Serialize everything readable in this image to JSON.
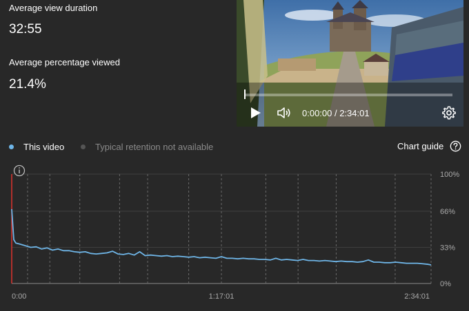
{
  "stats": {
    "avg_duration_label": "Average view duration",
    "avg_duration_value": "32:55",
    "avg_percent_label": "Average percentage viewed",
    "avg_percent_value": "21.4%"
  },
  "player": {
    "current_time": "0:00:00",
    "total_time": "2:34:01",
    "separator": " / ",
    "icons": [
      "play-icon",
      "volume-icon",
      "gear-icon"
    ]
  },
  "legend": {
    "this_video": "This video",
    "this_video_color": "#6fb6e8",
    "typical": "Typical retention not available",
    "typical_color": "#555555"
  },
  "chart_guide": {
    "label": "Chart guide",
    "icon": "help-icon"
  },
  "chart_data": {
    "type": "line",
    "title": "",
    "xlabel": "",
    "ylabel": "",
    "x_ticks": [
      "0:00",
      "1:17:01",
      "2:34:01"
    ],
    "y_ticks": [
      "100%",
      "66%",
      "33%",
      "0%"
    ],
    "ylim": [
      0,
      100
    ],
    "xlim": [
      "0:00",
      "2:34:01"
    ],
    "grid": true,
    "series": [
      {
        "color": "#6fb6e8",
        "x": [
          "0:00",
          "0:45",
          "1:30",
          "3:00",
          "5:00",
          "7:00",
          "9:00",
          "11:00",
          "13:00",
          "15:00",
          "17:00",
          "19:00",
          "21:00",
          "23:00",
          "25:00",
          "27:00",
          "29:00",
          "31:00",
          "33:00",
          "35:00",
          "37:00",
          "39:00",
          "41:00",
          "43:00",
          "45:00",
          "47:00",
          "49:00",
          "51:00",
          "53:00",
          "55:00",
          "57:00",
          "59:00",
          "1:01:00",
          "1:03:00",
          "1:05:00",
          "1:07:00",
          "1:09:00",
          "1:11:00",
          "1:13:00",
          "1:15:00",
          "1:17:01",
          "1:19:00",
          "1:21:00",
          "1:23:00",
          "1:25:00",
          "1:27:00",
          "1:29:00",
          "1:31:00",
          "1:33:00",
          "1:35:00",
          "1:37:00",
          "1:39:00",
          "1:41:00",
          "1:43:00",
          "1:45:00",
          "1:47:00",
          "1:49:00",
          "1:51:00",
          "1:53:00",
          "1:55:00",
          "1:57:00",
          "1:59:00",
          "2:01:00",
          "2:03:00",
          "2:05:00",
          "2:07:00",
          "2:09:00",
          "2:11:00",
          "2:13:00",
          "2:15:00",
          "2:17:00",
          "2:19:00",
          "2:21:00",
          "2:23:00",
          "2:25:00",
          "2:27:00",
          "2:29:00",
          "2:31:00",
          "2:33:00",
          "2:34:01"
        ],
        "values": [
          68,
          40,
          37,
          36,
          34.5,
          33,
          33.5,
          31.5,
          32.5,
          30.5,
          31.5,
          30,
          30,
          29,
          28.5,
          29,
          27.5,
          27,
          27.5,
          28,
          29.5,
          27,
          26.5,
          27.5,
          26,
          29,
          25.5,
          26,
          25.5,
          25,
          25.5,
          24.5,
          25,
          24.5,
          24,
          24.5,
          23.5,
          24,
          23.5,
          23,
          24.5,
          23,
          23,
          22.5,
          23,
          22.5,
          22.5,
          22,
          22,
          21.5,
          23,
          21.5,
          22,
          21.5,
          21,
          22,
          21,
          21,
          20.5,
          21,
          20.5,
          20,
          20.5,
          20,
          20,
          19.5,
          20,
          21.5,
          19.5,
          19.5,
          19,
          19,
          19.5,
          19,
          18.5,
          18.5,
          18.5,
          18,
          17.5,
          17
        ]
      }
    ],
    "vertical_markers": [
      "5:49",
      "14:00",
      "25:00",
      "39:37",
      "49:55",
      "1:05:00",
      "1:17:01",
      "1:33:20",
      "1:45:10",
      "1:59:10",
      "2:20:50"
    ],
    "annotation_icon": "info-icon"
  }
}
